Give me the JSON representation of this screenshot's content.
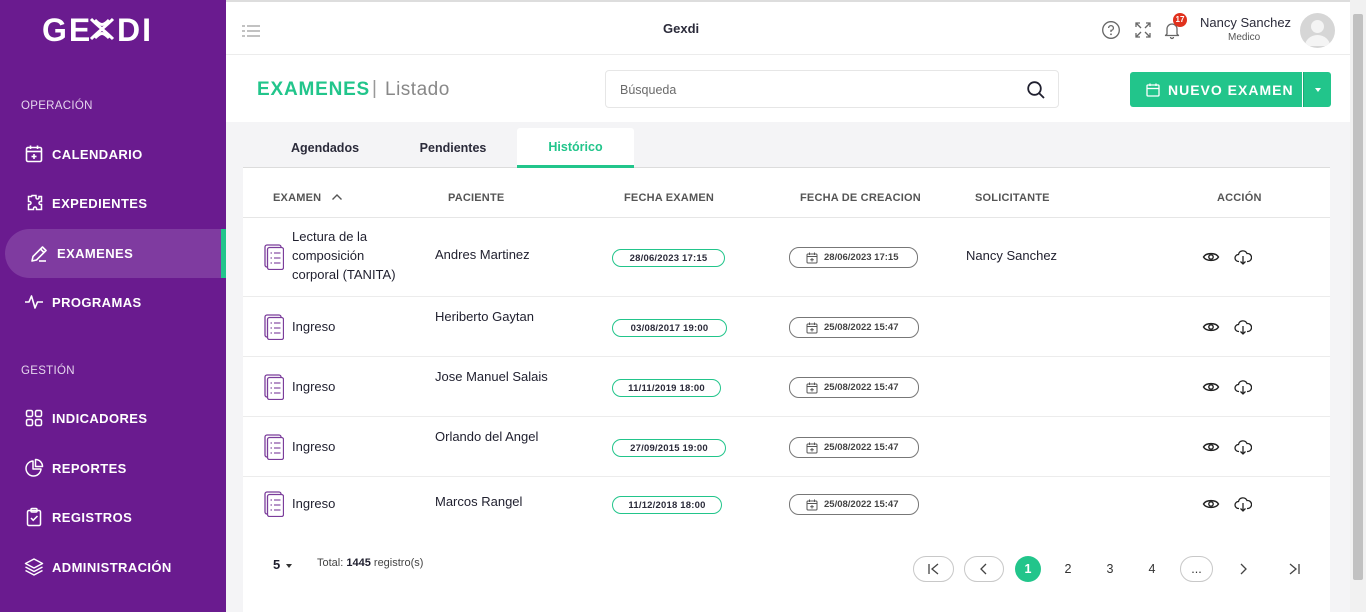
{
  "app": {
    "logo": "GEXDI",
    "title": "Gexdi"
  },
  "sidebar": {
    "sections": {
      "operacion": "OPERACIÓN",
      "gestion": "GESTIÓN"
    },
    "items": [
      {
        "label": "CALENDARIO",
        "icon": "calendar-icon"
      },
      {
        "label": "EXPEDIENTES",
        "icon": "puzzle-icon"
      },
      {
        "label": "EXAMENES",
        "icon": "pen-icon",
        "active": true
      },
      {
        "label": "PROGRAMAS",
        "icon": "pulse-icon"
      },
      {
        "label": "INDICADORES",
        "icon": "grid-icon"
      },
      {
        "label": "REPORTES",
        "icon": "pie-chart-icon"
      },
      {
        "label": "REGISTROS",
        "icon": "clipboard-icon"
      },
      {
        "label": "ADMINISTRACIÓN",
        "icon": "layers-icon"
      }
    ]
  },
  "topbar": {
    "notifications_count": "17",
    "user_name": "Nancy Sanchez",
    "user_role": "Medico"
  },
  "page": {
    "title": "EXAMENES",
    "separator": "|",
    "subtitle": "Listado",
    "search_placeholder": "Búsqueda",
    "new_button": "NUEVO EXAMEN"
  },
  "tabs": [
    {
      "label": "Agendados"
    },
    {
      "label": "Pendientes"
    },
    {
      "label": "Histórico",
      "active": true
    }
  ],
  "table": {
    "columns": [
      "EXAMEN",
      "PACIENTE",
      "FECHA EXAMEN",
      "FECHA DE CREACION",
      "SOLICITANTE",
      "ACCIÓN"
    ],
    "rows": [
      {
        "exam": "Lectura de la composición corporal (TANITA)",
        "patient": "Andres Martinez",
        "exam_date": "28/06/2023 17:15",
        "created": "28/06/2023 17:15",
        "requester": "Nancy Sanchez"
      },
      {
        "exam": "Ingreso",
        "patient": "Heriberto Gaytan",
        "exam_date": "03/08/2017 19:00",
        "created": "25/08/2022 15:47",
        "requester": ""
      },
      {
        "exam": "Ingreso",
        "patient": "Jose Manuel Salais",
        "exam_date": "11/11/2019 18:00",
        "created": "25/08/2022 15:47",
        "requester": ""
      },
      {
        "exam": "Ingreso",
        "patient": "Orlando del Angel",
        "exam_date": "27/09/2015 19:00",
        "created": "25/08/2022 15:47",
        "requester": ""
      },
      {
        "exam": "Ingreso",
        "patient": "Marcos Rangel",
        "exam_date": "11/12/2018 18:00",
        "created": "25/08/2022 15:47",
        "requester": ""
      }
    ]
  },
  "footer": {
    "page_size": "5",
    "total_label": "Total:",
    "total_count": "1445",
    "total_suffix": "registro(s)",
    "pages": [
      "1",
      "2",
      "3",
      "4",
      "..."
    ],
    "current_page": "1"
  },
  "colors": {
    "sidebar": "#6a1b8f",
    "accent": "#22c58b",
    "badge": "#e0311d"
  }
}
